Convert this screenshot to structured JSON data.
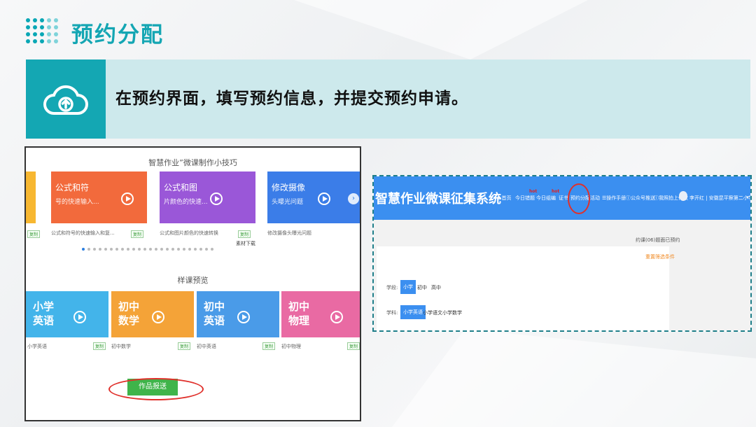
{
  "slide": {
    "title": "预约分配",
    "instruction": "在预约界面，填写预约信息，并提交预约申请。",
    "banner_icon": "cloud-upload-icon",
    "accent_color": "#14a7b3"
  },
  "left_screenshot": {
    "tips_heading": "智慧作业”微课制作小技巧",
    "tip_cards": [
      {
        "title": "公式和符",
        "subtitle": "号的快速输入...",
        "caption": "公式和符号的快速输入和复...",
        "tag": "复制",
        "color": "#f26a3c"
      },
      {
        "title": "公式和图",
        "subtitle": "片颜色的快速...",
        "caption": "公式和图片颜色的快速转换",
        "tag": "复制",
        "color": "#9a57d8"
      },
      {
        "title": "修改摄像",
        "subtitle": "头曝光问题",
        "caption": "修改摄像头曝光问题",
        "tag": "复制",
        "color": "#3b7de8"
      }
    ],
    "download_label": "素材下载",
    "preview_heading": "样课预览",
    "sample_cards": [
      {
        "title": "小学\n英语",
        "caption": "小学英语",
        "tag": "复制",
        "color": "#43b4ea"
      },
      {
        "title": "初中\n数学",
        "caption": "初中数学",
        "tag": "复制",
        "color": "#f4a338"
      },
      {
        "title": "初中\n英语",
        "caption": "初中英语",
        "tag": "复制",
        "color": "#4a9be8"
      },
      {
        "title": "初中\n物理",
        "caption": "初中物理",
        "tag": "复制",
        "color": "#e96aa3"
      }
    ],
    "submit_label": "作品报送"
  },
  "right_screenshot": {
    "system_title": "智慧作业微课征集系统",
    "nav": [
      "首页",
      "今日错题",
      "今日组编",
      "证书",
      "预约分配",
      "活动",
      "操作手册",
      "公众号推送",
      "我照拍上传收"
    ],
    "hot_badge": "hot",
    "user_label": "李开红 | 安徽昆平察第二小学 |",
    "notice": "约课(06)题面已预约",
    "filter_link": "重置筛选条件",
    "stage_label": "学段:",
    "stages": [
      "小学",
      "初中",
      "高中"
    ],
    "subject_label": "学科:",
    "subjects": [
      "小学英语",
      "小学语文",
      "小学数学"
    ]
  }
}
